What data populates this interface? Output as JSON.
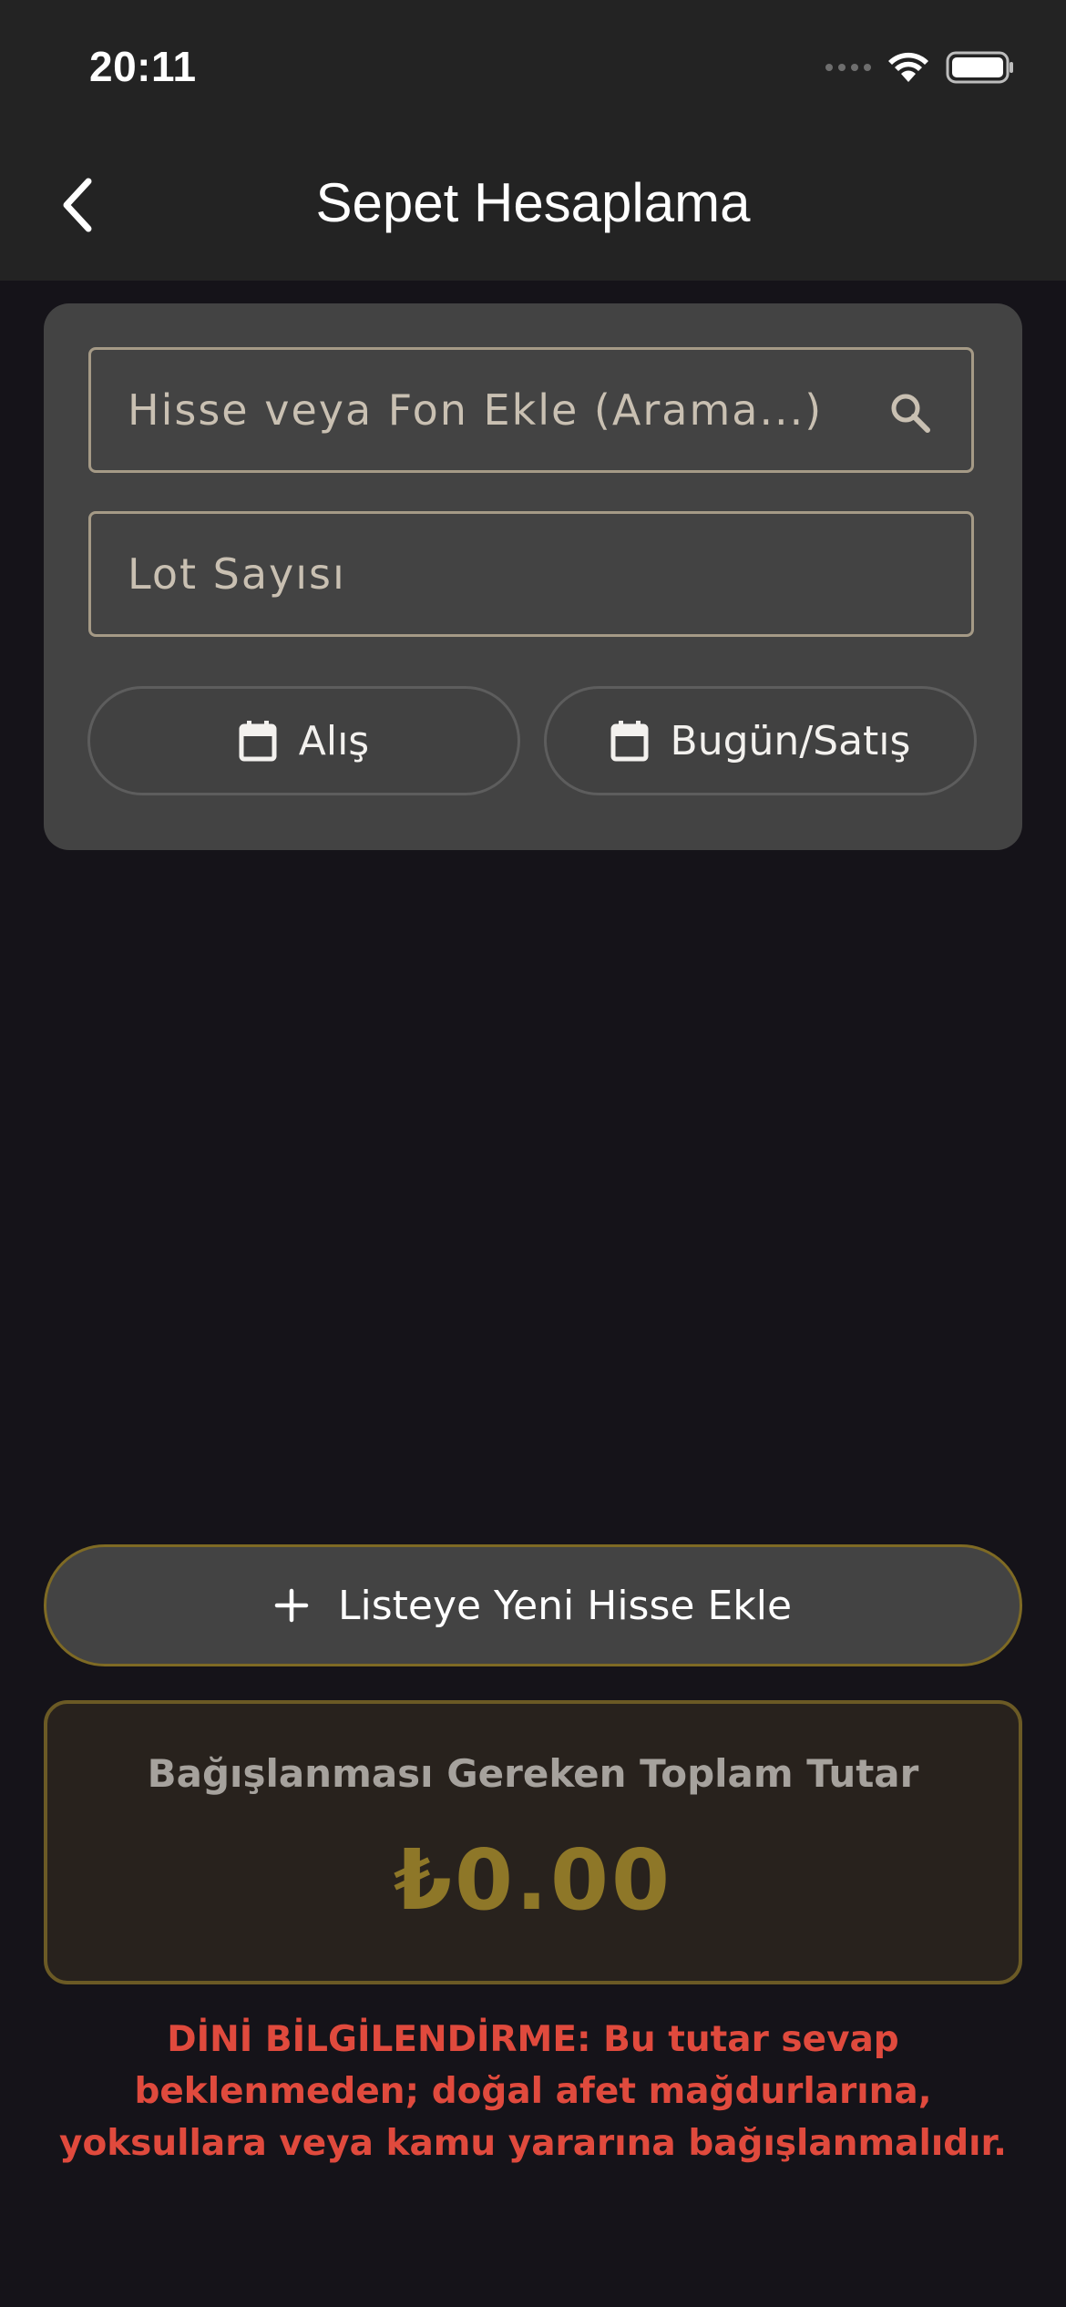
{
  "status_bar": {
    "time": "20:11",
    "icons": [
      "signal-icon",
      "wifi-icon",
      "battery-icon"
    ]
  },
  "nav": {
    "back_icon": "chevron-left-icon",
    "title": "Sepet Hesaplama"
  },
  "form": {
    "search_placeholder": "Hisse veya Fon Ekle (Arama...)",
    "search_value": "",
    "search_icon": "search-icon",
    "lot_placeholder": "Lot Sayısı",
    "lot_value": "",
    "buy_date_label": "Alış",
    "sell_date_label": "Bugün/Satış",
    "date_icon": "calendar-icon"
  },
  "add_button": {
    "label": "Listeye Yeni Hisse Ekle",
    "icon": "plus-icon"
  },
  "total": {
    "label": "Bağışlanması Gereken Toplam Tutar",
    "value": "₺0.00"
  },
  "notice": "DİNİ BİLGİLENDİRME: Bu tutar sevap beklenmeden; doğal afet mağdurlarına, yoksullara veya kamu yararına bağışlanmalıdır.",
  "colors": {
    "background": "#151319",
    "card": "#434343",
    "accent_gold": "#8e7728",
    "warning_red": "#e04a3d"
  }
}
